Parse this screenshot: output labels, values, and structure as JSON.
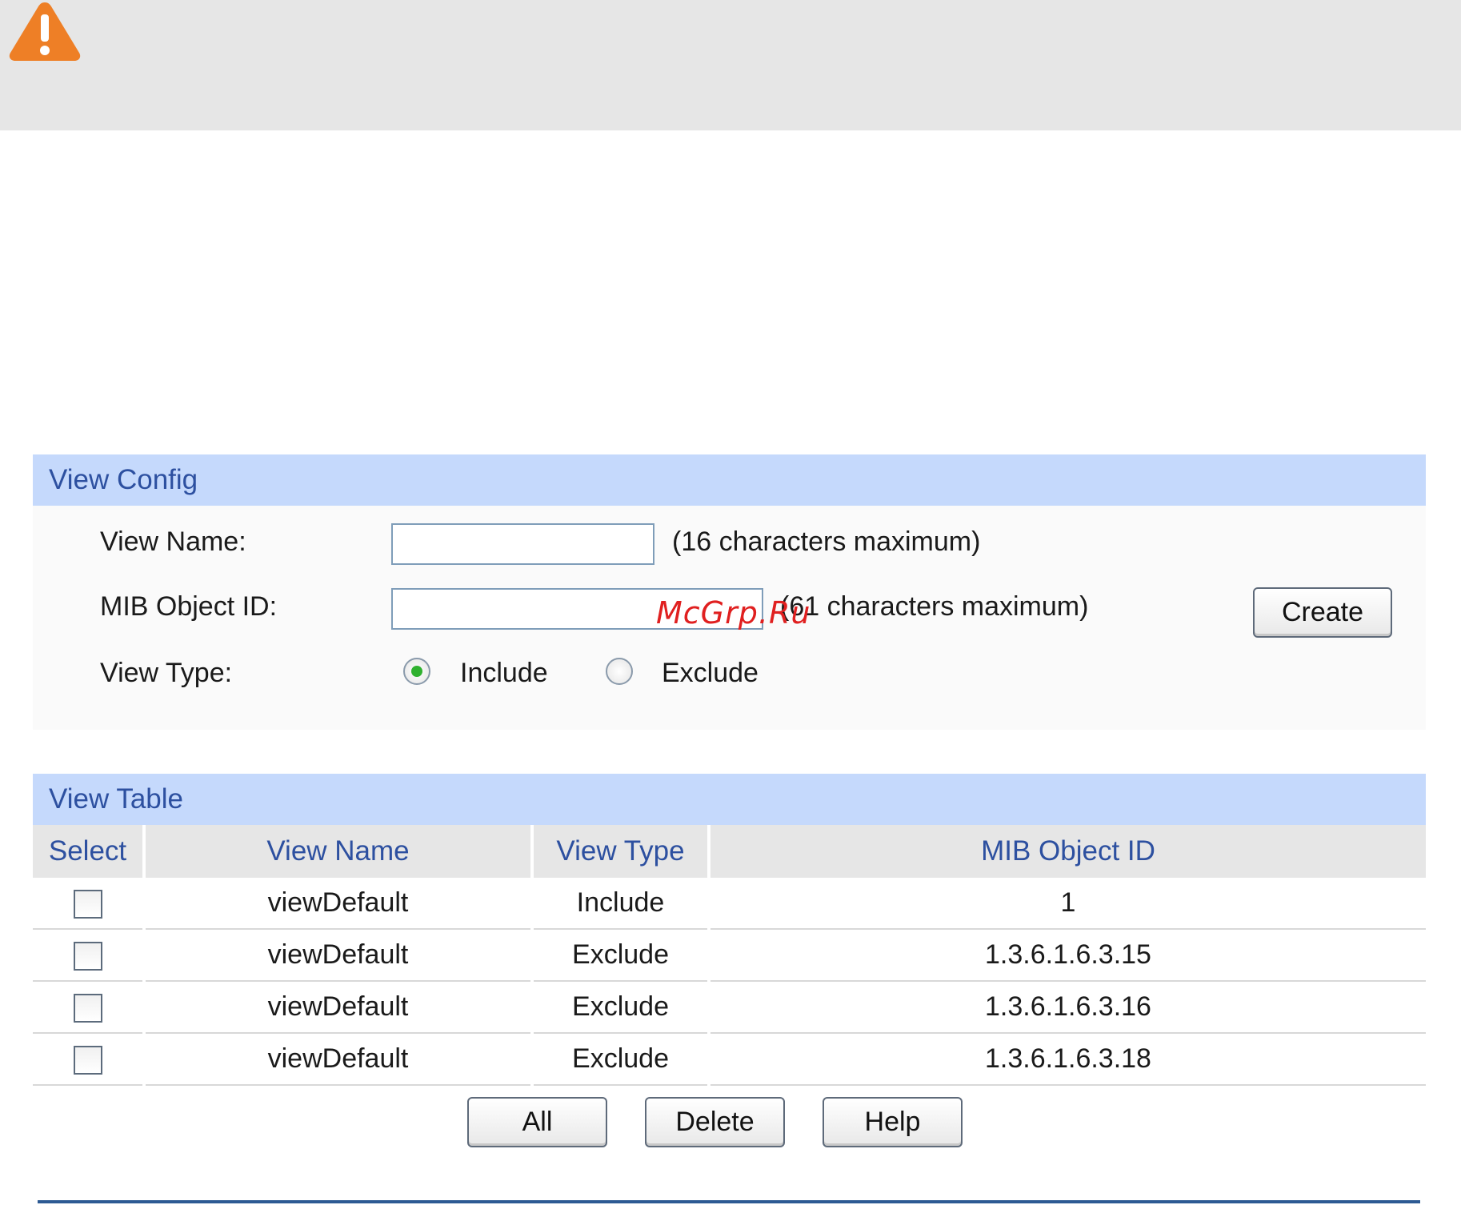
{
  "warning": {
    "icon": "warning-triangle-icon",
    "accent_color": "#ee7f26"
  },
  "view_config": {
    "header": "View Config",
    "view_name_label": "View Name:",
    "view_name_value": "",
    "view_name_hint": "(16 characters maximum)",
    "mib_object_id_label": "MIB Object ID:",
    "mib_object_id_value": "",
    "mib_object_id_hint": "(61 characters maximum)",
    "create_button": "Create",
    "view_type_label": "View Type:",
    "view_type_options": [
      "Include",
      "Exclude"
    ],
    "view_type_selected": "Include"
  },
  "view_table": {
    "header": "View Table",
    "columns": [
      "Select",
      "View Name",
      "View Type",
      "MIB Object ID"
    ],
    "rows": [
      {
        "view_name": "viewDefault",
        "view_type": "Include",
        "mib_object_id": "1"
      },
      {
        "view_name": "viewDefault",
        "view_type": "Exclude",
        "mib_object_id": "1.3.6.1.6.3.15"
      },
      {
        "view_name": "viewDefault",
        "view_type": "Exclude",
        "mib_object_id": "1.3.6.1.6.3.16"
      },
      {
        "view_name": "viewDefault",
        "view_type": "Exclude",
        "mib_object_id": "1.3.6.1.6.3.18"
      }
    ],
    "all_button": "All",
    "delete_button": "Delete",
    "help_button": "Help"
  },
  "watermark": "McGrp.Ru",
  "colors": {
    "header_bg": "#c5d9fc",
    "header_text": "#2d50a0",
    "radio_selected": "#2fb12f"
  }
}
